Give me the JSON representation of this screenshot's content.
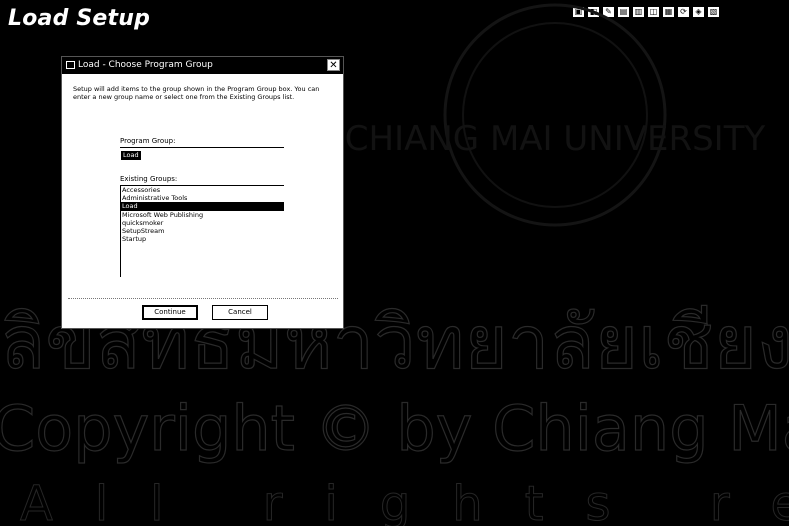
{
  "page": {
    "title": "Load Setup"
  },
  "tray": {
    "icons": [
      "app-icon-1",
      "app-icon-2",
      "app-icon-3",
      "app-icon-4",
      "app-icon-5",
      "app-icon-6",
      "app-icon-7",
      "app-icon-8",
      "app-icon-9",
      "app-icon-10"
    ]
  },
  "watermark": {
    "line1": "ลิขสิทธิ์มหาวิทยาลัยเชียงใหม่",
    "line2": "Copyright © by Chiang Mai University",
    "line3": "All rights reserved",
    "seal_text": "CHIANG MAI UNIVERSITY"
  },
  "dialog": {
    "title": "Load - Choose Program Group",
    "close_label": "✕",
    "description": "Setup will add items to the group shown in the Program Group box. You can enter a new group name or select one from the Existing Groups list.",
    "program_group_label": "Program Group:",
    "program_group_value": "Load",
    "existing_groups_label": "Existing Groups:",
    "existing_groups": [
      "Accessories",
      "Administrative Tools",
      "Load",
      "Microsoft Web Publishing",
      "quicksmoker",
      "SetupStream",
      "Startup"
    ],
    "selected_group": "Load",
    "continue_label": "Continue",
    "cancel_label": "Cancel"
  }
}
